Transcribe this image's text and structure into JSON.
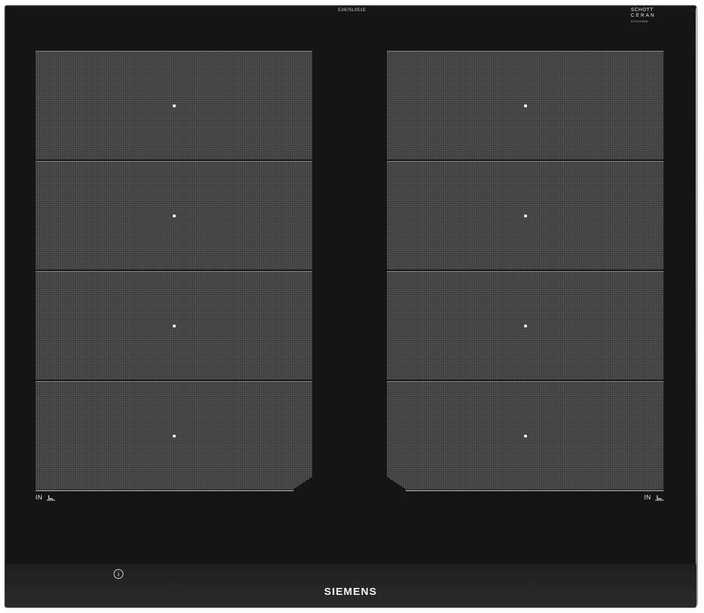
{
  "product": {
    "model_code": "EX675LXE1E",
    "glass_brand": {
      "line1": "SCHOTT",
      "line2": "CERAN",
      "line3": "9101070086"
    },
    "manufacturer_logo": "SIEMENS"
  },
  "cooking_zones": {
    "left_column_count": 4,
    "right_column_count": 4,
    "left_indicator": {
      "label": "IN",
      "icon": "pot-on-zone-icon"
    },
    "right_indicator": {
      "label": "IN",
      "icon": "pot-on-zone-icon"
    }
  },
  "controls": {
    "info_button": {
      "symbol": "i",
      "icon": "info-icon"
    }
  },
  "colors": {
    "glass": "#151515",
    "zone_fill": "#3a3a3a",
    "marker": "#f2f2f2",
    "frame": "#9a9a9a"
  }
}
